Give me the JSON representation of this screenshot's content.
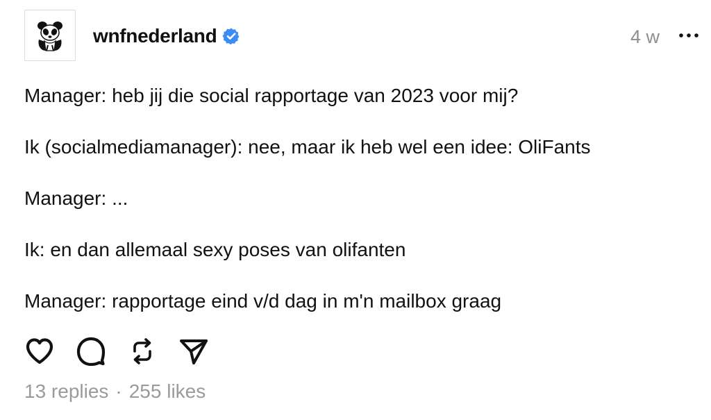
{
  "post": {
    "author": {
      "username": "wnfnederland",
      "verified": true,
      "avatar_icon": "panda-logo-icon"
    },
    "time_ago": "4 w",
    "more_icon": "more-options-icon",
    "lines": [
      "Manager: heb jij die social rapportage van 2023 voor mij?",
      "Ik (socialmediamanager): nee, maar ik heb wel een idee: OliFants",
      "Manager: ...",
      "Ik: en dan allemaal sexy poses van olifanten",
      "Manager: rapportage eind v/d dag in m'n mailbox graag"
    ],
    "actions": {
      "like_icon": "heart-icon",
      "reply_icon": "comment-icon",
      "repost_icon": "repost-icon",
      "share_icon": "send-icon"
    },
    "stats": {
      "replies": "13 replies",
      "separator": "·",
      "likes": "255 likes"
    }
  },
  "colors": {
    "verified_badge": "#3d8bf5",
    "muted_text": "#9a9a9a",
    "text": "#111111"
  }
}
